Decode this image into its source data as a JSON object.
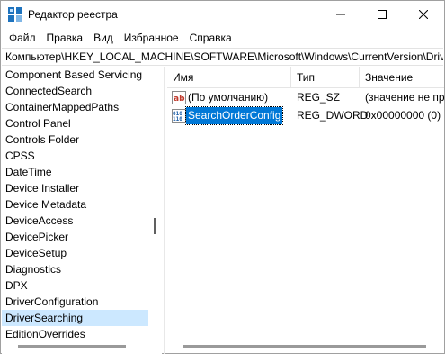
{
  "window": {
    "title": "Редактор реестра"
  },
  "menu": [
    "Файл",
    "Правка",
    "Вид",
    "Избранное",
    "Справка"
  ],
  "address": "Компьютер\\HKEY_LOCAL_MACHINE\\SOFTWARE\\Microsoft\\Windows\\CurrentVersion\\DriverSearching",
  "tree": {
    "items": [
      "Component Based Servicing",
      "ConnectedSearch",
      "ContainerMappedPaths",
      "Control Panel",
      "Controls Folder",
      "CPSS",
      "DateTime",
      "Device Installer",
      "Device Metadata",
      "DeviceAccess",
      "DevicePicker",
      "DeviceSetup",
      "Diagnostics",
      "DPX",
      "DriverConfiguration",
      "DriverSearching",
      "EditionOverrides"
    ],
    "selected": "DriverSearching"
  },
  "list": {
    "columns": [
      "Имя",
      "Тип",
      "Значение"
    ],
    "rows": [
      {
        "name": "(По умолчанию)",
        "type": "REG_SZ",
        "value": "(значение не присвоено)",
        "icon": "string-value-icon"
      },
      {
        "name": "SearchOrderConfig",
        "type": "REG_DWORD",
        "value": "0x00000000 (0)",
        "icon": "binary-value-icon"
      }
    ]
  },
  "colors": {
    "selection": "#0078d7",
    "tree_selection": "#cce8ff"
  }
}
